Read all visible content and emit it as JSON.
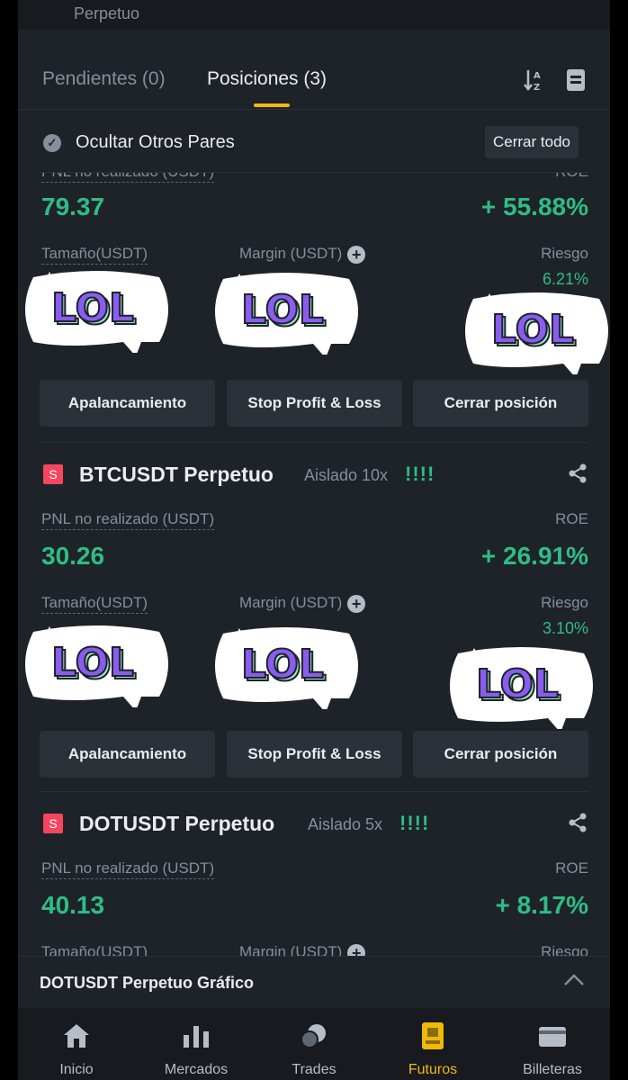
{
  "top": {
    "title": "Perpetuo"
  },
  "tabs": {
    "pending": "Pendientes (0)",
    "positions": "Posiciones (3)"
  },
  "icons": {
    "sort": "sort-az-icon",
    "doc": "document-icon"
  },
  "filter": {
    "hide_label": "Ocultar Otros Pares",
    "close_all": "Cerrar todo"
  },
  "labels": {
    "pnl": "PNL no realizado (USDT)",
    "roe": "ROE",
    "size": "Tamaño(USDT)",
    "margin": "Margin (USDT)",
    "risk": "Riesgo"
  },
  "buttons": {
    "leverage": "Apalancamiento",
    "tpsl": "Stop Profit & Loss",
    "close": "Cerrar posición"
  },
  "sticker": {
    "text": "LOL",
    "color": "#8a5cf0",
    "accent": "#9be8c9"
  },
  "positions": [
    {
      "pnl": "79.37",
      "roe": "+ 55.88%",
      "risk": "6.21%"
    },
    {
      "badge": "S",
      "symbol": "BTCUSDT Perpetuo",
      "mode": "Aislado 10x",
      "bars": "!!!!",
      "pnl": "30.26",
      "roe": "+ 26.91%",
      "risk": "3.10%"
    },
    {
      "badge": "S",
      "symbol": "DOTUSDT Perpetuo",
      "mode": "Aislado 5x",
      "bars": "!!!!",
      "pnl": "40.13",
      "roe": "+ 8.17%"
    }
  ],
  "chart_bar": {
    "label": "DOTUSDT Perpetuo  Gráfico"
  },
  "nav": [
    {
      "label": "Inicio",
      "icon": "home-icon"
    },
    {
      "label": "Mercados",
      "icon": "markets-icon"
    },
    {
      "label": "Trades",
      "icon": "trades-icon"
    },
    {
      "label": "Futuros",
      "icon": "futures-icon",
      "active": true
    },
    {
      "label": "Billeteras",
      "icon": "wallet-icon"
    }
  ],
  "colors": {
    "bg": "#1e2329",
    "green": "#2ebd85",
    "red": "#f6465d",
    "yellow": "#f0b90b",
    "muted": "#848e9c"
  }
}
